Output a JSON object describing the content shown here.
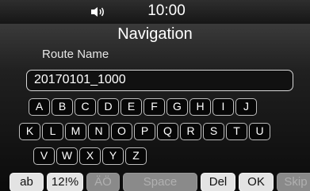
{
  "status": {
    "clock": "10:00",
    "volume_icon": "speaker-volume-icon"
  },
  "screen": {
    "title": "Navigation",
    "field_label": "Route Name"
  },
  "input": {
    "value": "20170101_1000"
  },
  "keyboard": {
    "row1": [
      "A",
      "B",
      "C",
      "D",
      "E",
      "F",
      "G",
      "H",
      "I",
      "J"
    ],
    "row2": [
      "K",
      "L",
      "M",
      "N",
      "O",
      "P",
      "Q",
      "R",
      "S",
      "T",
      "U"
    ],
    "row3": [
      "V",
      "W",
      "X",
      "Y",
      "Z"
    ]
  },
  "bottom_bar": {
    "ab": "ab",
    "symbols": "12!%",
    "accent": "ÄÖ",
    "space": "Space",
    "delete": "Del",
    "ok": "OK",
    "skip": "Skip"
  }
}
